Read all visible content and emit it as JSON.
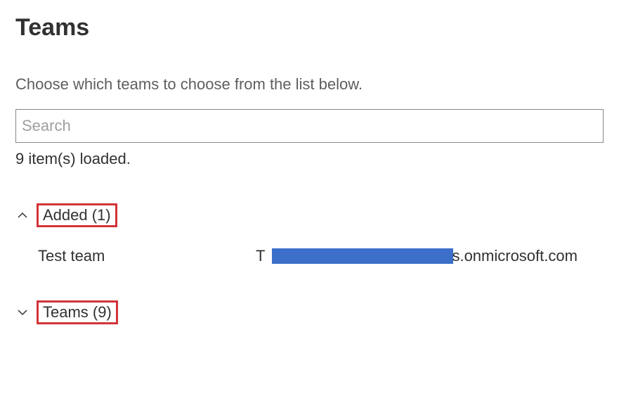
{
  "header": {
    "title": "Teams",
    "subtitle": "Choose which teams to choose from the list below."
  },
  "search": {
    "placeholder": "Search",
    "value": ""
  },
  "status": {
    "loaded_text": "9 item(s) loaded."
  },
  "groups": {
    "added": {
      "label": "Added (1)",
      "expanded": true,
      "items": [
        {
          "name": "Test team",
          "email_prefix": "T",
          "email_suffix": "s.onmicrosoft.com"
        }
      ]
    },
    "teams": {
      "label": "Teams (9)",
      "expanded": false
    }
  }
}
